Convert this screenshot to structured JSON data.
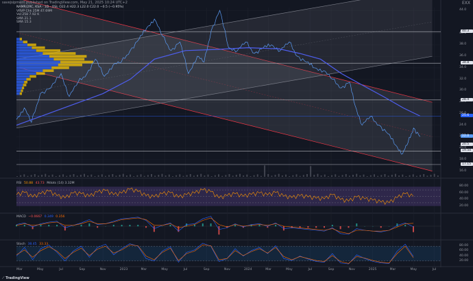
{
  "header": {
    "published_by": "savejsipment published on TradingView.com, May 21, 2025 10:24 UTC+2",
    "close_label": "EXX"
  },
  "legend": {
    "symbol_line": "NAMR/2RC, KSA · 1D · OSL  O22.4  H22.3  L22.0  C22.0  −0.5 (−0.95%)",
    "vrvp": "VRVP  Chk 25M  47.69M",
    "vol": "Vol  258  7.92 K",
    "sma1": "SMA  21.1",
    "sma2": "SMA  15.3"
  },
  "rsi_legend": {
    "label": "RSI",
    "value": "50.88",
    "level": "43.73",
    "extra": "Mdots (14)  3.32M"
  },
  "macd_legend": {
    "label": "MACD",
    "value": "−0.0667",
    "v2": "0.349",
    "v3": "0.356"
  },
  "stoch_legend": {
    "label": "Stoch",
    "value": "38.45",
    "v2": "33.33"
  },
  "chart_data": {
    "type": "line",
    "title": "",
    "x_ticks": [
      "Mar",
      "May",
      "Jul",
      "Sep",
      "Nov",
      "2023",
      "Mar",
      "May",
      "Jul",
      "Sep",
      "Nov",
      "2024",
      "Mar",
      "May",
      "Jul",
      "Sep",
      "Nov",
      "2025",
      "Mar",
      "May",
      "Jul"
    ],
    "y_ticks": [
      "44.0",
      "40.0",
      "38.0",
      "36.0",
      "34.0",
      "32.0",
      "30.0",
      "28.0",
      "26.0",
      "24.0",
      "22.0",
      "20.0",
      "18.0",
      "16.0"
    ],
    "ylim": [
      15.0,
      44.5
    ],
    "price_labels": [
      {
        "text": "40.3",
        "value": 40.3,
        "color": "#e0e3eb",
        "text_color": "#131722"
      },
      {
        "text": "34.8",
        "value": 34.8,
        "color": "#e0e3eb",
        "text_color": "#131722"
      },
      {
        "text": "28.4",
        "value": 28.4,
        "color": "#e0e3eb",
        "text_color": "#131722"
      },
      {
        "text": "25.6",
        "value": 25.6,
        "color": "#2962ff",
        "text_color": "#ffffff"
      },
      {
        "text": "22.0",
        "value": 22.0,
        "color": "#5b9cf6",
        "text_color": "#ffffff"
      },
      {
        "text": "20.5",
        "value": 20.6,
        "color": "#e0e3eb",
        "text_color": "#131722"
      },
      {
        "text": "19.50",
        "value": 19.5,
        "color": "#e0e3eb",
        "text_color": "#131722"
      },
      {
        "text": "17.15",
        "value": 17.15,
        "color": "#e0e3eb",
        "text_color": "#131722"
      }
    ],
    "horizontal_levels": [
      40.3,
      34.8,
      28.4,
      25.6,
      19.5,
      17.15
    ],
    "price_series": {
      "name": "",
      "color": "#5b9cf6",
      "x": [
        "2022-02-20",
        "2022-03-15",
        "2022-04-05",
        "2022-05-01",
        "2022-06-01",
        "2022-07-01",
        "2022-07-25",
        "2022-08-20",
        "2022-09-15",
        "2022-10-10",
        "2022-11-05",
        "2022-12-01",
        "2022-12-25",
        "2023-01-20",
        "2023-02-15",
        "2023-03-10",
        "2023-04-01",
        "2023-04-25",
        "2023-05-20",
        "2023-06-15",
        "2023-07-10",
        "2023-08-05",
        "2023-08-25",
        "2023-09-15",
        "2023-10-10",
        "2023-11-05",
        "2023-12-01",
        "2023-12-25",
        "2024-01-20",
        "2024-02-15",
        "2024-03-10",
        "2024-04-05",
        "2024-05-01",
        "2024-05-25",
        "2024-06-20",
        "2024-07-15",
        "2024-08-10",
        "2024-09-05",
        "2024-10-01",
        "2024-10-25",
        "2024-11-10",
        "2024-12-01",
        "2024-12-25",
        "2025-01-20",
        "2025-02-15",
        "2025-03-10",
        "2025-03-30",
        "2025-04-15",
        "2025-05-01",
        "2025-05-20"
      ],
      "y": [
        25.0,
        27.0,
        24.5,
        29.5,
        30.5,
        33.0,
        29.0,
        31.5,
        33.0,
        35.5,
        32.5,
        34.5,
        35.0,
        37.0,
        39.0,
        41.0,
        42.5,
        39.5,
        37.0,
        38.5,
        33.0,
        36.0,
        35.0,
        40.5,
        44.0,
        37.5,
        37.0,
        38.5,
        36.5,
        37.5,
        38.0,
        37.0,
        38.5,
        36.0,
        35.0,
        34.0,
        33.5,
        32.0,
        30.5,
        31.5,
        27.5,
        24.0,
        25.5,
        24.0,
        22.5,
        20.5,
        19.0,
        21.0,
        23.5,
        22.0
      ]
    },
    "sma_series": {
      "name": "",
      "color": "#4e5ef0",
      "x": [
        "2022-02-20",
        "2022-05-01",
        "2022-08-01",
        "2022-11-01",
        "2023-01-20",
        "2023-04-01",
        "2023-07-01",
        "2023-10-01",
        "2024-01-01",
        "2024-04-01",
        "2024-06-01",
        "2024-08-01",
        "2024-10-01",
        "2024-12-01",
        "2025-02-01",
        "2025-04-01",
        "2025-05-20"
      ],
      "y": [
        24.0,
        25.5,
        27.5,
        29.5,
        32.0,
        35.5,
        37.0,
        37.2,
        37.5,
        37.3,
        36.5,
        35.5,
        33.0,
        31.0,
        29.0,
        27.0,
        25.6
      ]
    },
    "channels": [
      {
        "name": "",
        "style": "down",
        "top_start": [
          "2022-03-01",
          46.0
        ],
        "top_end": [
          "2025-06-25",
          28.0
        ],
        "bot_start": [
          "2022-03-01",
          34.0
        ],
        "bot_end": [
          "2025-06-25",
          16.0
        ],
        "fill": "rgba(120,123,134,0.22)",
        "stroke": "#f23645"
      },
      {
        "name": "",
        "style": "up",
        "top_start": [
          "2022-02-20",
          35.5
        ],
        "top_end": [
          "2025-06-25",
          48.0
        ],
        "bot_start": [
          "2022-02-20",
          23.5
        ],
        "bot_end": [
          "2025-06-25",
          36.0
        ],
        "fill": "rgba(120,123,134,0.18)",
        "stroke": "#787b86"
      }
    ],
    "volume_profile": {
      "color_up": "#2962ff",
      "color_down": "#f7c600",
      "levels": [
        {
          "price": 39.0,
          "up": 3,
          "down": 2
        },
        {
          "price": 38.5,
          "up": 6,
          "down": 4
        },
        {
          "price": 38.0,
          "up": 10,
          "down": 8
        },
        {
          "price": 37.5,
          "up": 14,
          "down": 12
        },
        {
          "price": 37.0,
          "up": 18,
          "down": 22
        },
        {
          "price": 36.5,
          "up": 24,
          "down": 30
        },
        {
          "price": 36.0,
          "up": 30,
          "down": 34
        },
        {
          "price": 35.5,
          "up": 34,
          "down": 28
        },
        {
          "price": 35.0,
          "up": 40,
          "down": 30
        },
        {
          "price": 34.5,
          "up": 38,
          "down": 22
        },
        {
          "price": 34.0,
          "up": 32,
          "down": 16
        },
        {
          "price": 33.5,
          "up": 24,
          "down": 10
        },
        {
          "price": 33.0,
          "up": 18,
          "down": 8
        },
        {
          "price": 32.5,
          "up": 12,
          "down": 6
        },
        {
          "price": 32.0,
          "up": 9,
          "down": 4
        },
        {
          "price": 31.5,
          "up": 7,
          "down": 3
        },
        {
          "price": 31.0,
          "up": 6,
          "down": 3
        },
        {
          "price": 30.5,
          "up": 5,
          "down": 2
        },
        {
          "price": 30.0,
          "up": 4,
          "down": 2
        },
        {
          "price": 29.5,
          "up": 3,
          "down": 2
        }
      ]
    },
    "rsi": {
      "color": "#ff9800",
      "levels": [
        70,
        50,
        30
      ],
      "y_ticks": [
        "80.00",
        "60.00",
        "40.00",
        "20.00"
      ],
      "values": [
        55,
        62,
        48,
        58,
        66,
        52,
        45,
        60,
        58,
        50,
        63,
        68,
        55,
        60,
        72,
        65,
        52,
        48,
        58,
        61,
        47,
        55,
        60,
        70,
        64,
        45,
        52,
        58,
        50,
        56,
        60,
        54,
        62,
        50,
        46,
        52,
        48,
        44,
        42,
        55,
        40,
        35,
        48,
        42,
        38,
        32,
        30,
        46,
        58,
        50
      ]
    },
    "macd": {
      "macd_color": "#2962ff",
      "signal_color": "#ff6d00",
      "values": [
        0.2,
        0.4,
        -0.1,
        0.3,
        0.5,
        0.6,
        -0.2,
        0.1,
        0.4,
        0.8,
        0.2,
        0.3,
        0.6,
        0.9,
        1.0,
        1.1,
        0.7,
        -0.3,
        0.1,
        0.4,
        -0.6,
        0.2,
        0.3,
        0.9,
        1.2,
        -0.4,
        -0.2,
        0.3,
        -0.1,
        0.2,
        0.3,
        0.0,
        0.4,
        -0.3,
        -0.2,
        -0.3,
        -0.4,
        -0.5,
        -0.6,
        -0.2,
        -0.9,
        -1.0,
        -0.3,
        -0.5,
        -0.6,
        -0.7,
        -0.5,
        0.1,
        0.4,
        -0.07
      ],
      "signal": [
        0.1,
        0.3,
        0.1,
        0.2,
        0.4,
        0.5,
        0.1,
        0.1,
        0.3,
        0.6,
        0.3,
        0.3,
        0.5,
        0.8,
        0.9,
        1.0,
        0.8,
        0.1,
        0.1,
        0.3,
        -0.2,
        0.0,
        0.2,
        0.7,
        1.0,
        0.2,
        -0.1,
        0.2,
        0.0,
        0.1,
        0.2,
        0.1,
        0.3,
        0.0,
        -0.1,
        -0.2,
        -0.3,
        -0.4,
        -0.5,
        -0.3,
        -0.7,
        -0.9,
        -0.5,
        -0.5,
        -0.6,
        -0.6,
        -0.5,
        -0.1,
        0.3,
        0.35
      ]
    },
    "stoch": {
      "k_color": "#2962ff",
      "d_color": "#ff6d00",
      "levels": [
        80,
        20
      ],
      "y_ticks": [
        "80.00",
        "60.00",
        "40.00",
        "20.00"
      ],
      "k": [
        40,
        75,
        25,
        70,
        85,
        55,
        20,
        60,
        80,
        35,
        75,
        88,
        45,
        70,
        90,
        80,
        30,
        20,
        60,
        78,
        15,
        55,
        65,
        92,
        80,
        18,
        30,
        70,
        40,
        62,
        75,
        50,
        82,
        30,
        22,
        40,
        28,
        18,
        15,
        50,
        12,
        8,
        45,
        30,
        18,
        12,
        10,
        60,
        88,
        38
      ],
      "d": [
        45,
        65,
        35,
        62,
        78,
        60,
        30,
        55,
        72,
        42,
        68,
        80,
        52,
        65,
        85,
        82,
        40,
        25,
        55,
        72,
        22,
        50,
        60,
        85,
        82,
        25,
        30,
        62,
        42,
        58,
        70,
        52,
        75,
        38,
        25,
        38,
        30,
        22,
        18,
        42,
        18,
        10,
        38,
        32,
        22,
        15,
        12,
        50,
        80,
        33
      ]
    }
  }
}
